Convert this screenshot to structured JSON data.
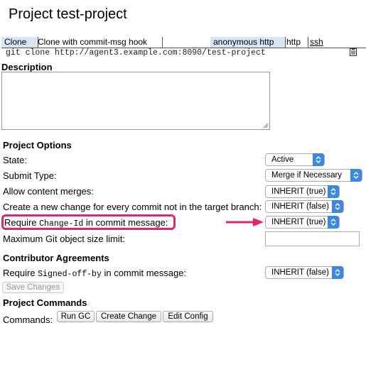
{
  "page": {
    "title": "Project test-project"
  },
  "clone": {
    "tabs": [
      {
        "label": "Clone"
      },
      {
        "label": "Clone with commit-msg hook"
      },
      {
        "label": "anonymous http"
      },
      {
        "label": "http"
      },
      {
        "label": "ssh"
      }
    ],
    "command": "git clone http://agent3.example.com:8090/test-project"
  },
  "description": {
    "heading": "Description",
    "value": ""
  },
  "project_options": {
    "heading": "Project Options",
    "rows": [
      {
        "label": "State:",
        "value": "Active"
      },
      {
        "label": "Submit Type:",
        "value": "Merge if Necessary"
      },
      {
        "label": "Allow content merges:",
        "value": "INHERIT (true)"
      },
      {
        "label": "Create a new change for every commit not in the target branch:",
        "value": "INHERIT (false)"
      },
      {
        "label_pre": "Require ",
        "label_code": "Change-Id",
        "label_post": " in commit message:",
        "value": "INHERIT (true)"
      },
      {
        "label": "Maximum Git object size limit:",
        "value": ""
      }
    ]
  },
  "contributor": {
    "heading": "Contributor Agreements",
    "label_pre": "Require ",
    "label_code": "Signed-off-by",
    "label_post": " in commit message:",
    "value": "INHERIT (false)",
    "save_label": "Save Changes"
  },
  "commands": {
    "heading": "Project Commands",
    "label": "Commands:",
    "buttons": [
      "Run GC",
      "Create Change",
      "Edit Config"
    ]
  },
  "colors": {
    "highlight": "#e8226d",
    "select_arrow": "#3b87e8",
    "tab_selected": "#d4e6f5"
  }
}
